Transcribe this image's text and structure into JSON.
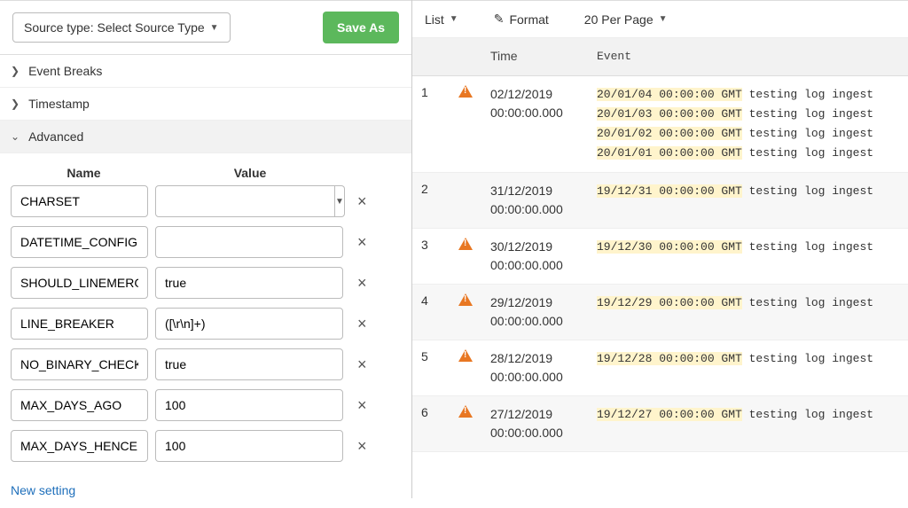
{
  "topbar": {
    "source_type_label": "Source type: Select Source Type",
    "save_as_label": "Save As"
  },
  "sections": {
    "event_breaks": "Event Breaks",
    "timestamp": "Timestamp",
    "advanced": "Advanced"
  },
  "advanced": {
    "head_name": "Name",
    "head_value": "Value",
    "new_setting": "New setting",
    "rows": [
      {
        "name": "CHARSET",
        "value": "",
        "dropdown": true
      },
      {
        "name": "DATETIME_CONFIG",
        "value": ""
      },
      {
        "name": "SHOULD_LINEMERGE",
        "value": "true"
      },
      {
        "name": "LINE_BREAKER",
        "value": "([\\r\\n]+)"
      },
      {
        "name": "NO_BINARY_CHECK",
        "value": "true"
      },
      {
        "name": "MAX_DAYS_AGO",
        "value": "100"
      },
      {
        "name": "MAX_DAYS_HENCE",
        "value": "100"
      }
    ]
  },
  "right_toolbar": {
    "list": "List",
    "format": "Format",
    "per_page": "20 Per Page"
  },
  "events": {
    "head_time": "Time",
    "head_event": "Event",
    "rows": [
      {
        "n": "1",
        "warn": true,
        "time1": "02/12/2019",
        "time2": "00:00:00.000",
        "lines": [
          {
            "hl": "20/01/04 00:00:00 GMT",
            "rest": " testing log ingest"
          },
          {
            "hl": "20/01/03 00:00:00 GMT",
            "rest": " testing log ingest"
          },
          {
            "hl": "20/01/02 00:00:00 GMT",
            "rest": " testing log ingest"
          },
          {
            "hl": "20/01/01 00:00:00 GMT",
            "rest": " testing log ingest"
          }
        ]
      },
      {
        "n": "2",
        "warn": false,
        "time1": "31/12/2019",
        "time2": "00:00:00.000",
        "lines": [
          {
            "hl": "19/12/31 00:00:00 GMT",
            "rest": " testing log ingest"
          }
        ]
      },
      {
        "n": "3",
        "warn": true,
        "time1": "30/12/2019",
        "time2": "00:00:00.000",
        "lines": [
          {
            "hl": "19/12/30 00:00:00 GMT",
            "rest": " testing log ingest"
          }
        ]
      },
      {
        "n": "4",
        "warn": true,
        "time1": "29/12/2019",
        "time2": "00:00:00.000",
        "lines": [
          {
            "hl": "19/12/29 00:00:00 GMT",
            "rest": " testing log ingest"
          }
        ]
      },
      {
        "n": "5",
        "warn": true,
        "time1": "28/12/2019",
        "time2": "00:00:00.000",
        "lines": [
          {
            "hl": "19/12/28 00:00:00 GMT",
            "rest": " testing log ingest"
          }
        ]
      },
      {
        "n": "6",
        "warn": true,
        "time1": "27/12/2019",
        "time2": "00:00:00.000",
        "lines": [
          {
            "hl": "19/12/27 00:00:00 GMT",
            "rest": " testing log ingest"
          }
        ]
      }
    ]
  }
}
